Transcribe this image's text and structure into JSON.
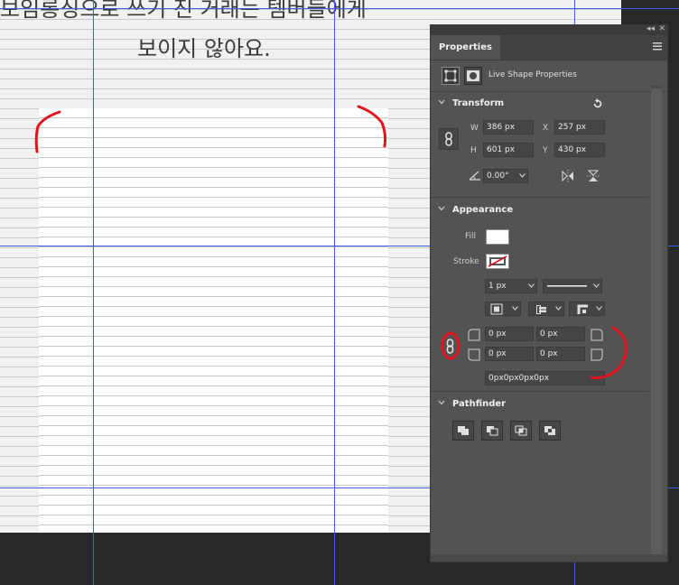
{
  "document": {
    "text_line1": "보임롱싱으로 쓰기 진 거래는 템버들에게",
    "text_line2": "보이지 않아요."
  },
  "panel": {
    "tab_label": "Properties",
    "kind_label": "Live Shape Properties",
    "transform": {
      "title": "Transform",
      "w_label": "W",
      "w_value": "386 px",
      "x_label": "X",
      "x_value": "257 px",
      "h_label": "H",
      "h_value": "601 px",
      "y_label": "Y",
      "y_value": "430 px",
      "angle_value": "0.00°"
    },
    "appearance": {
      "title": "Appearance",
      "fill_label": "Fill",
      "stroke_label": "Stroke",
      "stroke_width": "1 px",
      "corners": {
        "top_left": "0 px",
        "top_right": "0 px",
        "bottom_left": "0 px",
        "bottom_right": "0 px",
        "combined": "0px0px0px0px"
      }
    },
    "pathfinder": {
      "title": "Pathfinder"
    }
  },
  "colors": {
    "panel_bg": "#535353",
    "guide": "#3f5fe0",
    "annotation": "#e0141e",
    "fill_swatch": "#ffffff"
  }
}
